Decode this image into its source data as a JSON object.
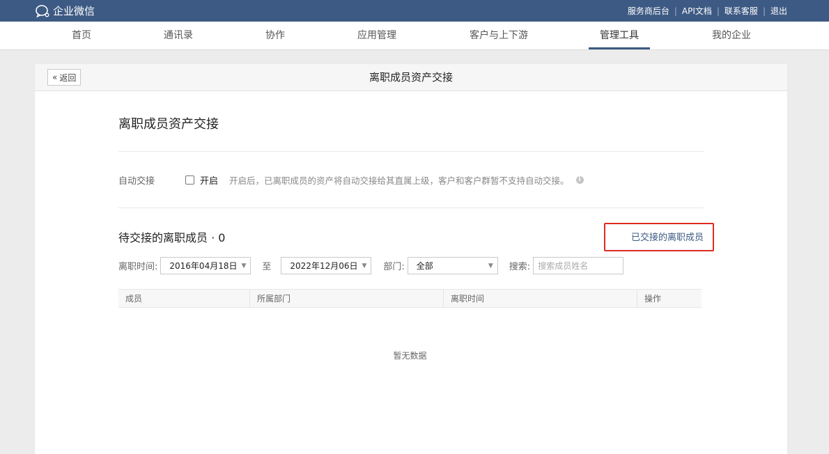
{
  "topbar": {
    "brand": "企业微信",
    "links": [
      "服务商后台",
      "API文档",
      "联系客服",
      "退出"
    ]
  },
  "nav": {
    "tabs": [
      "首页",
      "通讯录",
      "协作",
      "应用管理",
      "客户与上下游",
      "管理工具",
      "我的企业"
    ],
    "active": "管理工具"
  },
  "card": {
    "back_label": "返回",
    "header_title": "离职成员资产交接",
    "section_title": "离职成员资产交接",
    "auto": {
      "label": "自动交接",
      "checkbox_label": "开启",
      "checked": false,
      "hint": "开启后，已离职成员的资产将自动交接给其直属上级，客户和客户群暂不支持自动交接。"
    },
    "pending_title": "待交接的离职成员 · 0",
    "done_link": "已交接的离职成员",
    "filters": {
      "time_label": "离职时间:",
      "start_date": "2016年04月18日",
      "to_label": "至",
      "end_date": "2022年12月06日",
      "dept_label": "部门:",
      "dept_value": "全部",
      "search_label": "搜索:",
      "search_placeholder": "搜索成员姓名",
      "search_value": ""
    },
    "table": {
      "columns": [
        "成员",
        "所属部门",
        "离职时间",
        "操作"
      ]
    },
    "empty_text": "暂无数据"
  },
  "colors": {
    "topbar": "#3d5a84",
    "highlight_box": "#e02a1e",
    "link": "#3d5a84"
  }
}
